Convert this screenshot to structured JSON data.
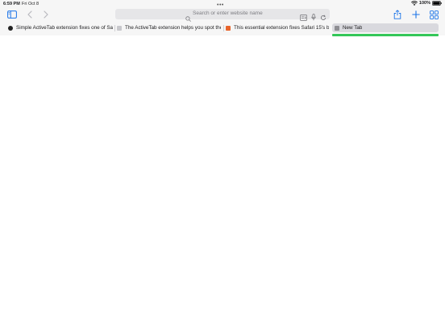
{
  "status": {
    "time": "6:59 PM",
    "date": "Fri Oct 8",
    "battery": "100%"
  },
  "address_bar": {
    "placeholder": "Search or enter website name"
  },
  "tabs": [
    {
      "title": "Simple ActiveTab extension fixes one of Sa",
      "favicon_color": "#222222"
    },
    {
      "title": "The ActiveTab extension helps you spot the",
      "favicon_color": "#c8c8cc"
    },
    {
      "title": "This essential extension fixes Safari 15's b",
      "favicon_color": "#e8642c"
    },
    {
      "title": "New Tab",
      "favicon_color": "#8e8e93",
      "active": true
    }
  ],
  "colors": {
    "accent": "#1a73e8",
    "progress": "#34c759"
  },
  "icons": [
    "sidebar-icon",
    "back-icon",
    "forward-icon",
    "search-icon",
    "reader-icon",
    "microphone-icon",
    "reload-icon",
    "share-icon",
    "plus-icon",
    "tab-overview-icon",
    "wifi-icon",
    "battery-icon"
  ]
}
